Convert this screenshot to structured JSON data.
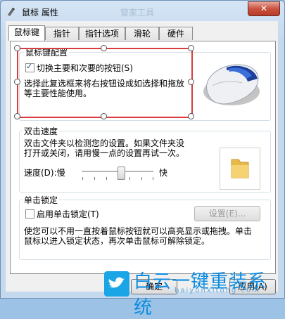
{
  "window": {
    "title": "鼠标 属性",
    "close_glyph": "✕",
    "watermark_top": "管家工具"
  },
  "tabs": [
    "鼠标键",
    "指针",
    "指针选项",
    "滑轮",
    "硬件"
  ],
  "button_config": {
    "group_label": "鼠标键配置",
    "swap_label": "切换主要和次要的按钮(S)",
    "swap_checked": true,
    "description": [
      "选择此复选框来将右按钮设成如选择和拖放",
      "等主要性能使用。"
    ]
  },
  "double_click": {
    "group_label": "双击速度",
    "description": [
      "双击文件夹以检测您的设置。如果文件夹没",
      "打开或关闭，请用慢一点的设置再试一次。"
    ],
    "speed_label": "速度(D):慢",
    "fast_label": "快",
    "speed_value": 0.55
  },
  "click_lock": {
    "group_label": "单击锁定",
    "enable_label": "启用单击锁定(T)",
    "enable_checked": false,
    "settings_button": "设置(E)...",
    "description": [
      "使您可以不用一直按着鼠标按钮就可以高亮显示或拖拽。单击",
      "鼠标以进入锁定状态，再次单击鼠标可解除锁定。"
    ]
  },
  "buttons": {
    "ok": "确定",
    "apply": "应用(A)"
  },
  "watermark": {
    "text": "白云一键重装系统",
    "sub": "baiyunxitong.com"
  }
}
